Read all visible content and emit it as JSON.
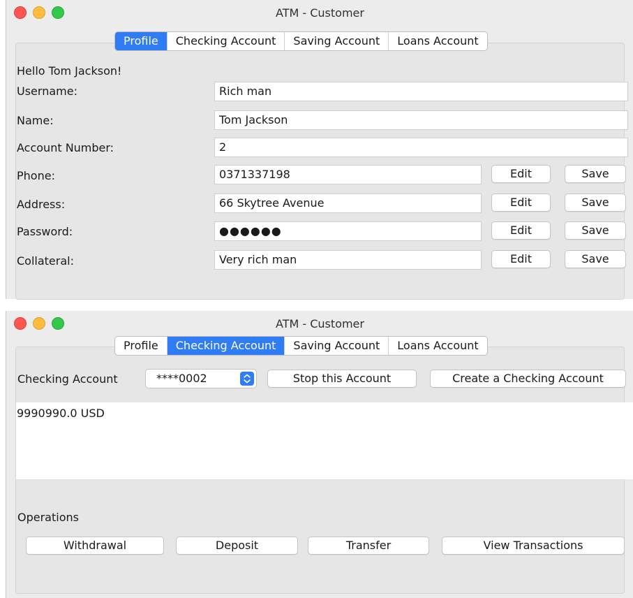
{
  "profile_window": {
    "title": "ATM - Customer",
    "tabs": [
      "Profile",
      "Checking Account",
      "Saving Account",
      "Loans Account"
    ],
    "active_tab": "Profile",
    "greeting": "Hello Tom Jackson!",
    "fields": {
      "username": {
        "label": "Username:",
        "value": "Rich man"
      },
      "name": {
        "label": "Name:",
        "value": "Tom Jackson"
      },
      "account_number": {
        "label": "Account Number:",
        "value": "2"
      },
      "phone": {
        "label": "Phone:",
        "value": "0371337198"
      },
      "address": {
        "label": "Address:",
        "value": "66 Skytree Avenue"
      },
      "password": {
        "label": "Password:",
        "value": "●●●●●●"
      },
      "collateral": {
        "label": "Collateral:",
        "value": "Very rich man"
      }
    },
    "edit_label": "Edit",
    "save_label": "Save"
  },
  "checking_window": {
    "title": "ATM - Customer",
    "tabs": [
      "Profile",
      "Checking Account",
      "Saving Account",
      "Loans Account"
    ],
    "active_tab": "Checking Account",
    "account_label": "Checking Account",
    "account_select_value": "****0002",
    "stop_button": "Stop this Account",
    "create_button": "Create a Checking Account",
    "balance": "9990990.0 USD",
    "operations_label": "Operations",
    "operations": [
      "Withdrawal",
      "Deposit",
      "Transfer",
      "View Transactions"
    ]
  },
  "colors": {
    "accent": "#2f7cf4",
    "close": "#fc5753",
    "minimize": "#fdbc40",
    "maximize": "#34c84a"
  }
}
